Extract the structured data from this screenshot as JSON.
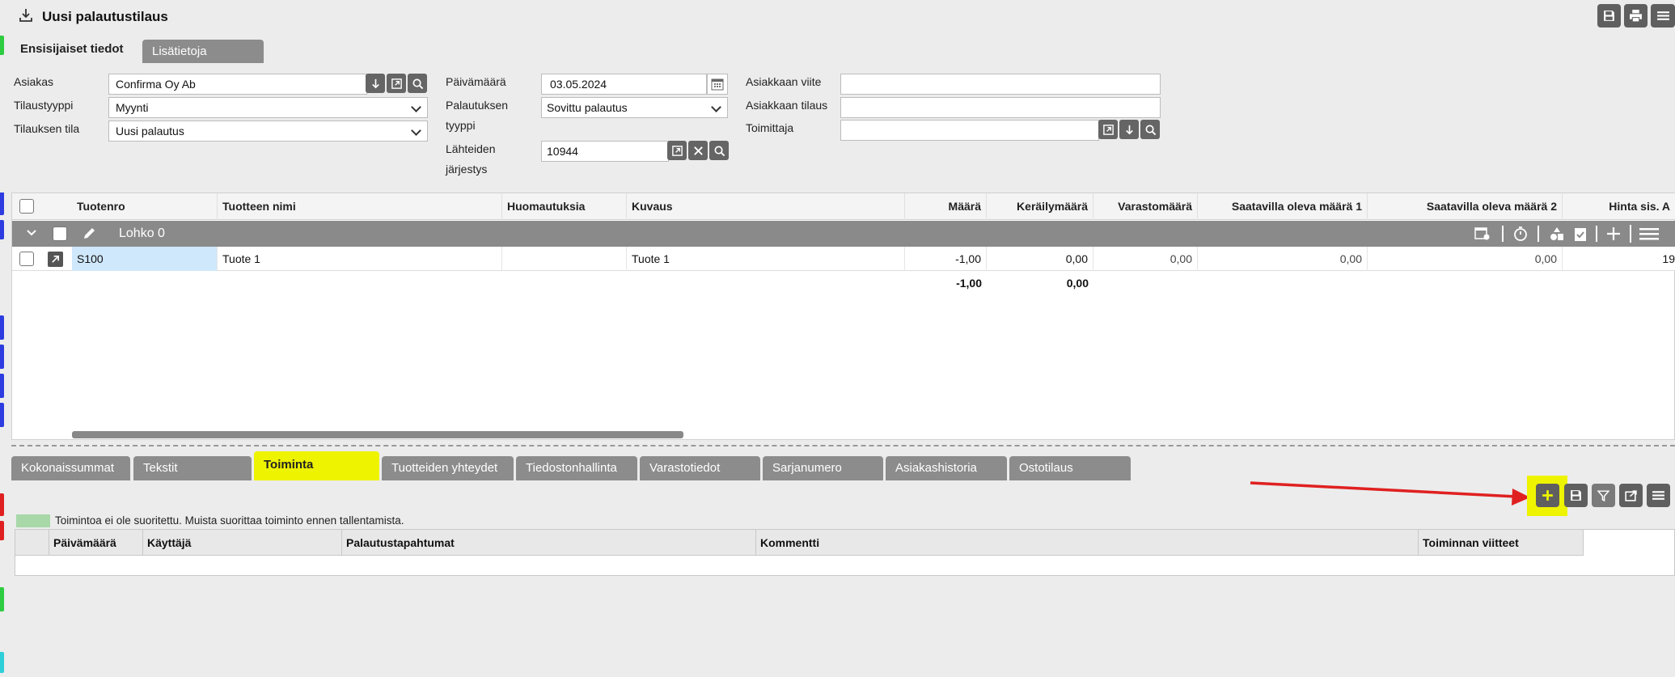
{
  "window": {
    "title": "Uusi palautustilaus"
  },
  "top_tabs": [
    "Ensisijaiset tiedot",
    "Lisätietoja"
  ],
  "form": {
    "asiakas_label": "Asiakas",
    "asiakas_value": "Confirma Oy Ab",
    "tilaustyyppi_label": "Tilaustyyppi",
    "tilaustyyppi_value": "Myynti",
    "tilauksen_tila_label": "Tilauksen tila",
    "tilauksen_tila_value": "Uusi palautus",
    "paivamaara_label": "Päivämäärä",
    "paivamaara_value": "03.05.2024",
    "palautuksen_tyyppi_label_1": "Palautuksen",
    "palautuksen_tyyppi_label_2": "tyyppi",
    "palautuksen_tyyppi_value": "Sovittu palautus",
    "lahteiden_label_1": "Lähteiden",
    "lahteiden_label_2": "järjestys",
    "lahteiden_value": "10944",
    "asiakkaan_viite_label": "Asiakkaan viite",
    "asiakkaan_viite_value": "",
    "asiakkaan_tilaus_label": "Asiakkaan tilaus",
    "asiakkaan_tilaus_value": "",
    "toimittaja_label": "Toimittaja",
    "toimittaja_value": ""
  },
  "grid": {
    "columns": [
      "Tuotenro",
      "Tuotteen nimi",
      "Huomautuksia",
      "Kuvaus",
      "Määrä",
      "Keräilymäärä",
      "Varastomäärä",
      "Saatavilla oleva määrä 1",
      "Saatavilla oleva määrä 2",
      "Hinta sis. A"
    ],
    "group_label": "Lohko 0",
    "rows": [
      {
        "tuotenro": "S100",
        "nimi": "Tuote 1",
        "huom": "",
        "kuvaus": "Tuote 1",
        "maara": "-1,00",
        "kerailymaara": "0,00",
        "varastomaara": "0,00",
        "saatavilla1": "0,00",
        "saatavilla2": "0,00",
        "hinta": "19"
      }
    ],
    "totals": {
      "maara": "-1,00",
      "kerailymaara": "0,00"
    }
  },
  "bottom_tabs": [
    "Kokonaissummat",
    "Tekstit",
    "Toiminta",
    "Tuotteiden yhteydet",
    "Tiedostonhallinta",
    "Varastotiedot",
    "Sarjanumero",
    "Asiakashistoria",
    "Ostotilaus"
  ],
  "active_bottom_tab": "Toiminta",
  "legend_text": "Toimintoa ei ole suoritettu. Muista suorittaa toiminto ennen tallentamista.",
  "action_table": {
    "columns": [
      "Päivämäärä",
      "Käyttäjä",
      "Palautustapahtumat",
      "Kommentti",
      "Toiminnan viitteet"
    ]
  },
  "colors": {
    "highlight": "#eef300",
    "arrow": "#e02020",
    "button": "#5f5f5f",
    "legend": "#a8d8a8"
  }
}
